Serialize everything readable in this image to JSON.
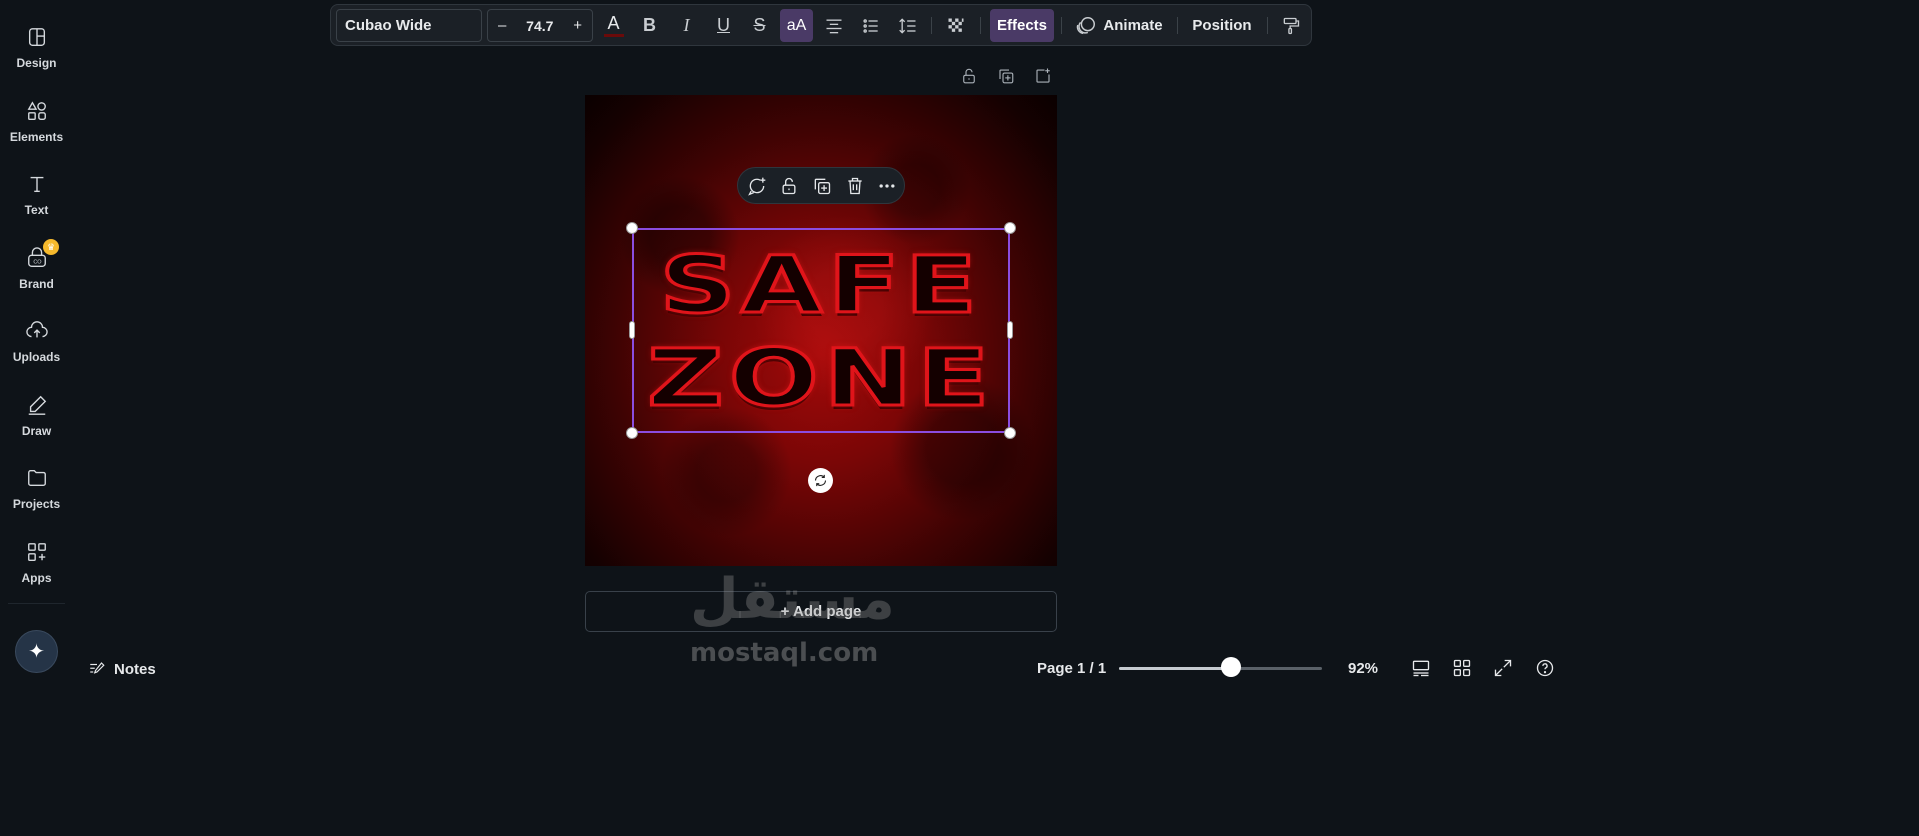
{
  "sidebar": {
    "items": [
      {
        "label": "Design",
        "icon": "design-icon"
      },
      {
        "label": "Elements",
        "icon": "elements-icon"
      },
      {
        "label": "Text",
        "icon": "text-icon"
      },
      {
        "label": "Brand",
        "icon": "brand-icon"
      },
      {
        "label": "Uploads",
        "icon": "uploads-icon"
      },
      {
        "label": "Draw",
        "icon": "draw-icon"
      },
      {
        "label": "Projects",
        "icon": "projects-icon"
      },
      {
        "label": "Apps",
        "icon": "apps-icon"
      }
    ],
    "magic_icon": "sparkle-icon"
  },
  "toolbar": {
    "font_name": "Cubao Wide",
    "font_size": "74.7",
    "decrease": "–",
    "increase": "+",
    "text_color_glyph": "A",
    "bold_glyph": "B",
    "italic_glyph": "I",
    "underline_glyph": "U",
    "strike_glyph": "S",
    "case_glyph": "aA",
    "effects_label": "Effects",
    "animate_label": "Animate",
    "position_label": "Position"
  },
  "canvas": {
    "line1": "SAFE",
    "line2": "ZONE"
  },
  "add_page_label": "+ Add page",
  "watermark": {
    "arabic": "مستقل",
    "latin": "mostaql.com"
  },
  "bottom_bar": {
    "notes_label": "Notes",
    "page_label": "Page 1 / 1",
    "zoom_label": "92%",
    "zoom_fraction": 0.55
  },
  "colors": {
    "accent": "#8b4de0",
    "active_button": "#4a3a66",
    "text_red": "#e0141a",
    "background": "#0e1318"
  }
}
